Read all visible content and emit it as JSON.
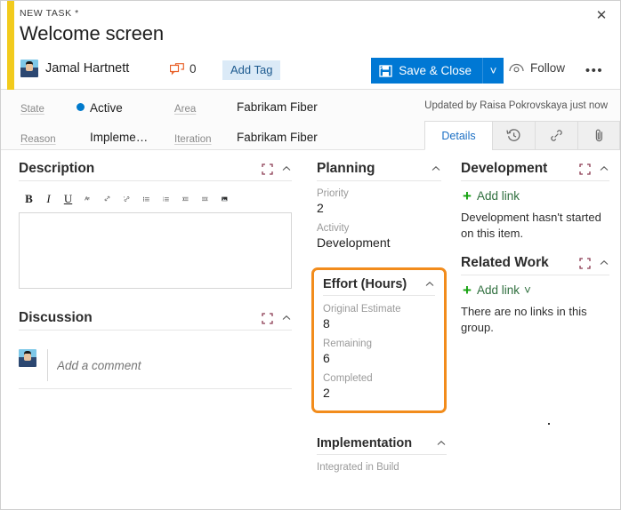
{
  "window": {
    "close_label": "✕",
    "accent_color": "#f2cb1d"
  },
  "header": {
    "breadcrumb": "NEW TASK *",
    "title": "Welcome screen",
    "assignee": "Jamal Hartnett",
    "comment_count": "0",
    "comment_icon": "comment-icon",
    "add_tag_label": "Add Tag",
    "save_label": "Save & Close",
    "save_icon": "save-disk-icon",
    "save_caret": "˅",
    "follow_label": "Follow",
    "follow_icon": "eye-icon",
    "more_label": "•••",
    "accent_blue": "#0078d4"
  },
  "fields": {
    "state_label": "State",
    "state_value": "Active",
    "state_color": "#007acc",
    "reason_label": "Reason",
    "reason_value": "Impleme…",
    "area_label": "Area",
    "area_value": "Fabrikam Fiber",
    "iteration_label": "Iteration",
    "iteration_value": "Fabrikam Fiber",
    "updated_text": "Updated by Raisa Pokrovskaya  just now"
  },
  "tabs": [
    {
      "label": "Details",
      "icon": "details-tab",
      "active": true
    },
    {
      "label": "",
      "icon": "history-clock-icon",
      "active": false
    },
    {
      "label": "",
      "icon": "link-chain-icon",
      "active": false
    },
    {
      "label": "",
      "icon": "paperclip-icon",
      "active": false
    }
  ],
  "description": {
    "title": "Description",
    "expand_icon": "expand-icon",
    "collapse_icon": "chevron-up-icon",
    "toolbar": [
      {
        "name": "bold-icon",
        "glyph": "B"
      },
      {
        "name": "italic-icon",
        "glyph": "I"
      },
      {
        "name": "underline-icon",
        "glyph": "U"
      },
      {
        "name": "clear-format-icon",
        "glyph": "A"
      },
      {
        "name": "link-icon",
        "glyph": "🔗"
      },
      {
        "name": "unlink-icon",
        "glyph": "🔗"
      },
      {
        "name": "bullet-list-icon",
        "glyph": "☰"
      },
      {
        "name": "numbered-list-icon",
        "glyph": "☰"
      },
      {
        "name": "outdent-icon",
        "glyph": "⇤"
      },
      {
        "name": "indent-icon",
        "glyph": "⇥"
      },
      {
        "name": "image-icon",
        "glyph": "▣"
      }
    ],
    "body_text": ""
  },
  "discussion": {
    "title": "Discussion",
    "expand_icon": "expand-icon",
    "collapse_icon": "chevron-up-icon",
    "comment_placeholder": "Add a comment"
  },
  "planning": {
    "title": "Planning",
    "collapse_icon": "chevron-up-icon",
    "priority_label": "Priority",
    "priority_value": "2",
    "activity_label": "Activity",
    "activity_value": "Development"
  },
  "effort": {
    "title": "Effort (Hours)",
    "collapse_icon": "chevron-up-icon",
    "highlight_color": "#f28c1c",
    "original_estimate_label": "Original Estimate",
    "original_estimate_value": "8",
    "remaining_label": "Remaining",
    "remaining_value": "6",
    "completed_label": "Completed",
    "completed_value": "2"
  },
  "implementation": {
    "title": "Implementation",
    "collapse_icon": "chevron-up-icon",
    "integrated_in_build_label": "Integrated in Build"
  },
  "development": {
    "title": "Development",
    "expand_icon": "expand-icon",
    "collapse_icon": "chevron-up-icon",
    "add_link_label": "Add link",
    "empty_note": "Development hasn't started on this item."
  },
  "related_work": {
    "title": "Related Work",
    "expand_icon": "expand-icon",
    "collapse_icon": "chevron-up-icon",
    "add_link_label": "Add link",
    "add_link_caret": "˅",
    "empty_note": "There are no links in this group."
  }
}
